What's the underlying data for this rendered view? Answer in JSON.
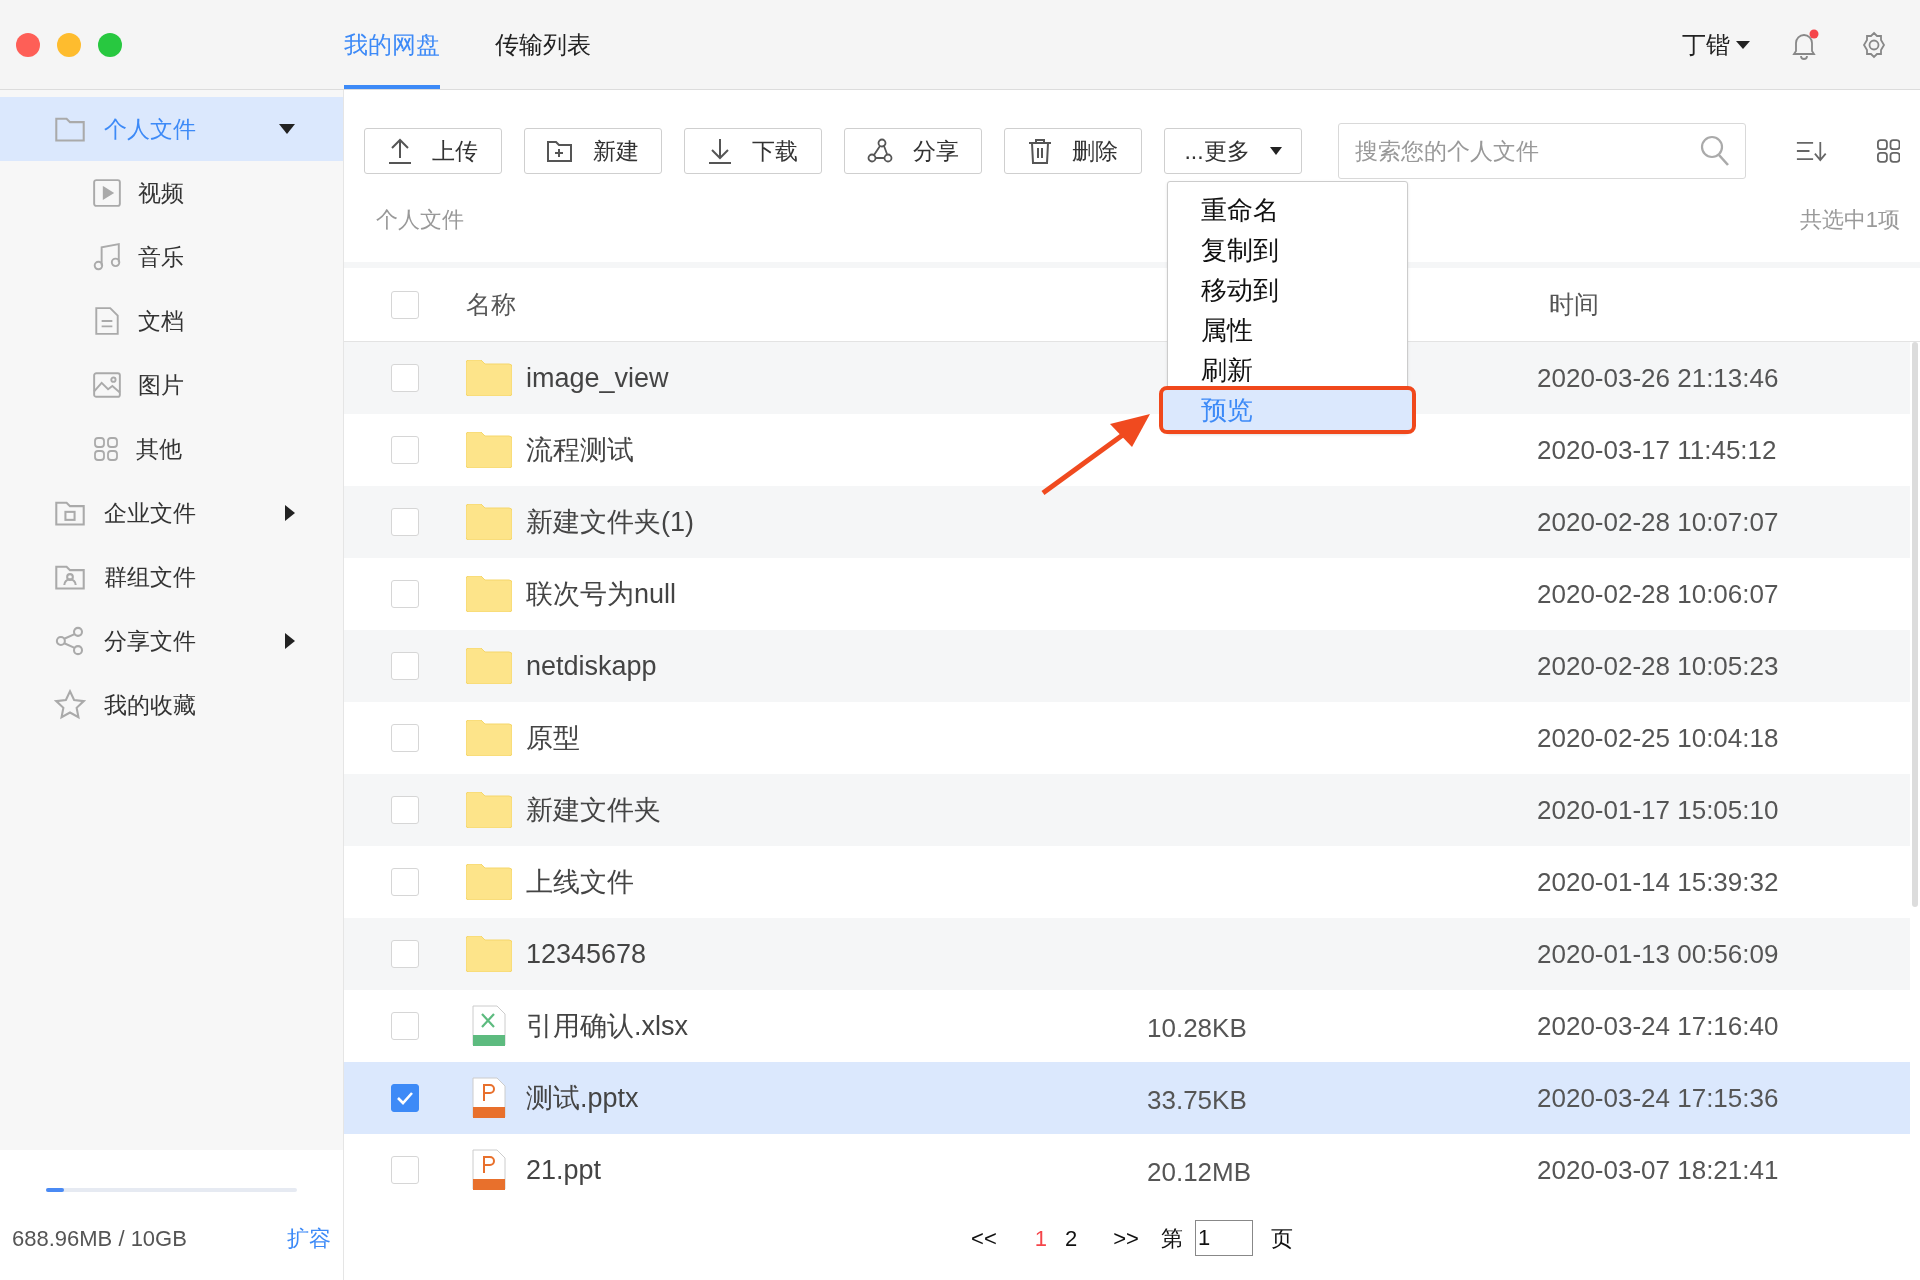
{
  "top_tabs": [
    {
      "label": "我的网盘",
      "selected": true
    },
    {
      "label": "传输列表",
      "selected": false
    }
  ],
  "user": {
    "name": "丁锴",
    "notification": true
  },
  "sidebar": {
    "items": [
      {
        "label": "个人文件",
        "kind": "folder",
        "selected": true,
        "expanded": true,
        "children": [
          {
            "label": "视频",
            "kind": "video",
            "selected": false
          },
          {
            "label": "音乐",
            "kind": "music",
            "selected": false
          },
          {
            "label": "文档",
            "kind": "doc",
            "selected": false
          },
          {
            "label": "图片",
            "kind": "image",
            "selected": false
          },
          {
            "label": "其他",
            "kind": "grid",
            "selected": false
          }
        ]
      },
      {
        "label": "企业文件",
        "kind": "company",
        "selected": false,
        "expanded": false
      },
      {
        "label": "群组文件",
        "kind": "group",
        "selected": false
      },
      {
        "label": "分享文件",
        "kind": "share",
        "selected": false,
        "expanded": false
      },
      {
        "label": "我的收藏",
        "kind": "star",
        "selected": false
      }
    ]
  },
  "storage": {
    "usage": "688.96MB / 10GB",
    "level": 0.07,
    "action": "扩容"
  },
  "toolbar": {
    "buttons": [
      {
        "label": "上传",
        "kind": "upload"
      },
      {
        "label": "新建",
        "kind": "new-folder"
      },
      {
        "label": "下载",
        "kind": "download"
      },
      {
        "label": "分享",
        "kind": "share"
      },
      {
        "label": "删除",
        "kind": "trash"
      },
      {
        "label": "...更多",
        "kind": "caret"
      }
    ],
    "search": {
      "placeholder": "搜索您的个人文件"
    }
  },
  "breadcrumb": "个人文件",
  "selection_count": "共选中1项",
  "table": {
    "select_all": {
      "checked": false
    },
    "columns": [
      "名称",
      "时间"
    ],
    "rows": [
      {
        "name": "image_view",
        "kind": "folder",
        "time": "2020-03-26 21:13:46",
        "checked": false
      },
      {
        "name": "流程测试",
        "kind": "folder",
        "time": "2020-03-17 11:45:12",
        "checked": false
      },
      {
        "name": "新建文件夹(1)",
        "kind": "folder",
        "time": "2020-02-28 10:07:07",
        "checked": false
      },
      {
        "name": "联次号为null",
        "kind": "folder",
        "time": "2020-02-28 10:06:07",
        "checked": false
      },
      {
        "name": "netdiskapp",
        "kind": "folder",
        "time": "2020-02-28 10:05:23",
        "checked": false
      },
      {
        "name": "原型",
        "kind": "folder",
        "time": "2020-02-25 10:04:18",
        "checked": false
      },
      {
        "name": "新建文件夹",
        "kind": "folder",
        "time": "2020-01-17 15:05:10",
        "checked": false
      },
      {
        "name": "上线文件",
        "kind": "folder",
        "time": "2020-01-14 15:39:32",
        "checked": false
      },
      {
        "name": "12345678",
        "kind": "folder",
        "time": "2020-01-13 00:56:09",
        "checked": false
      },
      {
        "name": "引用确认.xlsx",
        "kind": "xls",
        "size": "10.28KB",
        "time": "2020-03-24 17:16:40",
        "checked": false
      },
      {
        "name": "测试.pptx",
        "kind": "ppt",
        "size": "33.75KB",
        "time": "2020-03-24 17:15:36",
        "checked": true
      },
      {
        "name": "21.ppt",
        "kind": "ppt",
        "size": "20.12MB",
        "time": "2020-03-07 18:21:41",
        "checked": false
      }
    ]
  },
  "more_menu": {
    "items": [
      {
        "label": "重命名",
        "selected": false
      },
      {
        "label": "复制到",
        "selected": false
      },
      {
        "label": "移动到",
        "selected": false
      },
      {
        "label": "属性",
        "selected": false
      },
      {
        "label": "刷新",
        "selected": false
      },
      {
        "label": "预览",
        "selected": true
      }
    ]
  },
  "pagination": {
    "prev": "<<",
    "pages": [
      {
        "label": "1",
        "selected": true
      },
      {
        "label": "2",
        "selected": false
      }
    ],
    "next": ">>",
    "goto_prefix": "第",
    "goto_value": "1",
    "goto_suffix": "页"
  }
}
